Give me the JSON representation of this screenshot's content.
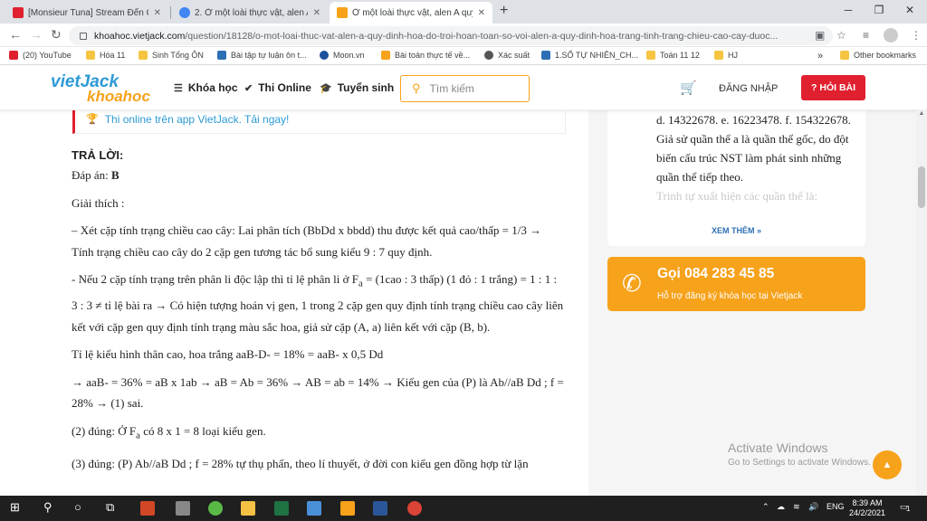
{
  "browser": {
    "tabs": [
      {
        "title": "[Monsieur Tuna] Stream Đến Chế",
        "color": "#e0202e"
      },
      {
        "title": "2. Ở một loài thực vật, alen A quy",
        "color": "#4285f4"
      },
      {
        "title": "Ở một loài thực vật, alen A quy đ",
        "color": "#f7a21b"
      }
    ],
    "close": "✕",
    "new_tab": "+",
    "win_min": "─",
    "win_max": "❐",
    "win_close": "✕",
    "url_domain": "khoahoc.vietjack.com",
    "url_path": "/question/18128/o-mot-loai-thuc-vat-alen-a-quy-dinh-hoa-do-troi-hoan-toan-so-voi-alen-a-quy-dinh-hoa-trang-tinh-trang-chieu-cao-cay-duoc...",
    "bookmarks": [
      {
        "label": "(20) YouTube",
        "color": "#e0202e"
      },
      {
        "label": "Hóa 11",
        "color": "#f5c542"
      },
      {
        "label": "Sinh Tổng ÔN",
        "color": "#f5c542"
      },
      {
        "label": "Bài tập tự luận ôn t...",
        "color": "#2d6fb4"
      },
      {
        "label": "Moon.vn",
        "color": "#1a4f9c"
      },
      {
        "label": "Bài toán thực tế về...",
        "color": "#f7a21b"
      },
      {
        "label": "Xác suất",
        "color": "#555555"
      },
      {
        "label": "1.SỐ TỰ NHIÊN_CH...",
        "color": "#2d6fb4"
      },
      {
        "label": "Toán 11 12",
        "color": "#f5c542"
      },
      {
        "label": "HJ",
        "color": "#f5c542"
      }
    ],
    "more_bookmarks": "»",
    "other_bookmarks": "Other bookmarks"
  },
  "site": {
    "logo_top": "vietJack",
    "logo_bottom": "khoahoc",
    "menu": [
      "Khóa học",
      "Thi Online",
      "Tuyển sinh"
    ],
    "search_placeholder": "Tìm kiếm",
    "login": "ĐĂNG NHẬP",
    "ask": "HỎI BÀI"
  },
  "banner": "Thi online trên app VietJack. Tải ngay!",
  "article": {
    "heading": "TRẢ LỜI:",
    "answer_label": "Đáp án: ",
    "answer_value": "B",
    "p0": "Giải thích :",
    "p1": "– Xét cặp tính trạng chiều cao cây: Lai phân tích (BbDd x bbdd) thu được kết quả cao/thấp = 1/3 → Tính trạng chiều cao cây do 2 cặp gen tương tác bổ sung kiểu 9 : 7 quy định.",
    "p2a": "- Nếu 2 cặp tính trạng trên phân li độc lập thì tỉ lệ phân li ở F",
    "p2sub": "a",
    "p2b": " = (1cao : 3 thấp) (1 đỏ : 1 trắng) = 1 : 1 : 3 : 3 ≠ tỉ lệ bài ra → Có hiện tượng hoán vị gen, 1 trong 2 cặp gen quy định tính trạng chiều cao cây liên kết với cặp gen quy định tính trạng màu sắc hoa, giả sử cặp (A, a) liên kết với cặp (B, b).",
    "p3": "Tỉ lệ kiểu hình thân cao, hoa trắng aaB-D- = 18% = aaB- x 0,5 Dd",
    "p4": "→ aaB- = 36% = aB x 1ab → aB = Ab = 36% → AB = ab = 14% → Kiểu gen của (P) là Ab//aB Dd ; f = 28% → (1) sai.",
    "p5a": "(2) đúng: Ở F",
    "p5sub": "a",
    "p5b": " có 8 x 1 = 8 loại kiểu gen.",
    "p6": "(3) đúng: (P) Ab//aB Dd ; f = 28% tự thụ phấn, theo lí thuyết, ở đời con kiểu gen đồng hợp từ lặn"
  },
  "right_card": {
    "options": "d. 14322678.     e. 16223478.     f. 154322678.",
    "text": "Giả sử quần thể a là quần thể gốc, do đột biến cấu trúc NST làm phát sinh những quần thể tiếp theo.",
    "faded": "Trình tự xuất hiện các quần thể là:",
    "more": "XEM THÊM »"
  },
  "call_box": {
    "title": "Gọi 084 283 45 85",
    "subtitle": "Hỗ trợ đăng ký khóa học tại Vietjack"
  },
  "watermark": {
    "line1": "Activate Windows",
    "line2": "Go to Settings to activate Windows."
  },
  "taskbar": {
    "lang": "ENG",
    "time": "8:39 AM",
    "date": "24/2/2021",
    "notif": "1"
  }
}
